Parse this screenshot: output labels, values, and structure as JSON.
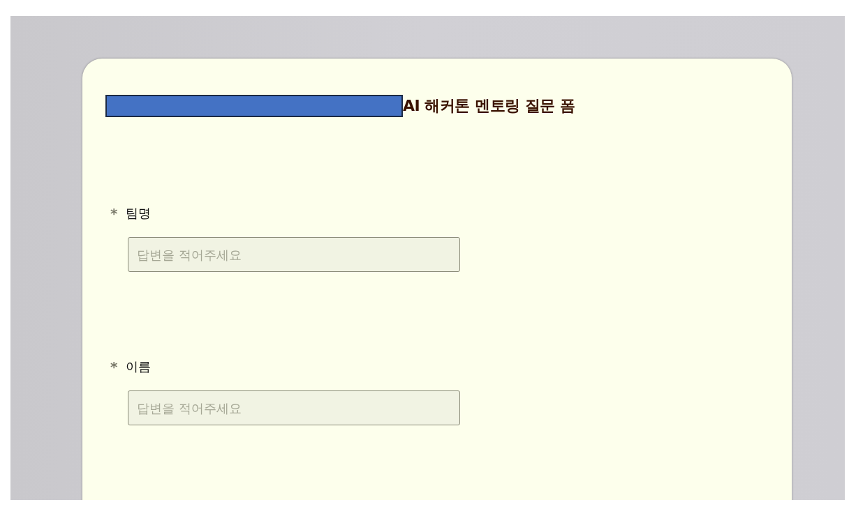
{
  "form": {
    "title_redacted": true,
    "title": "AI 해커톤 멘토링 질문 폼",
    "questions": [
      {
        "label": "팀명",
        "required": true,
        "required_mark": "*",
        "placeholder": "답변을 적어주세요"
      },
      {
        "label": "이름",
        "required": true,
        "required_mark": "*",
        "placeholder": "답변을 적어주세요"
      }
    ]
  }
}
